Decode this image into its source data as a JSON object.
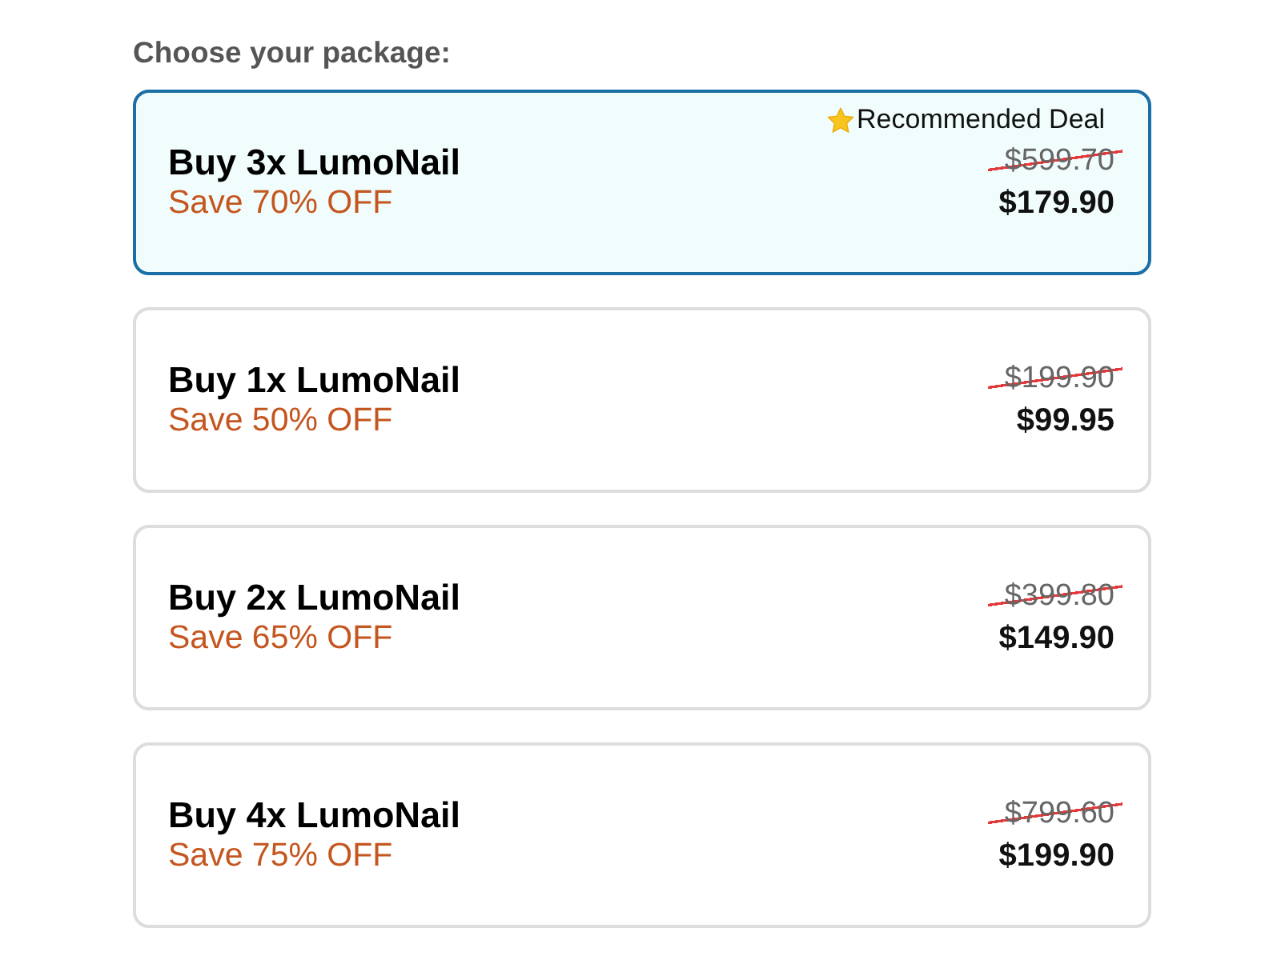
{
  "heading": "Choose your package:",
  "packages": [
    {
      "title": "Buy 3x LumoNail",
      "saving": "Save 70% OFF",
      "old_price": "$599.70",
      "price": "$179.90",
      "badge": "Recommended Deal",
      "selected": true
    },
    {
      "title": "Buy 1x LumoNail",
      "saving": "Save 50% OFF",
      "old_price": "$199.90",
      "price": "$99.95",
      "selected": false
    },
    {
      "title": "Buy 2x LumoNail",
      "saving": "Save 65% OFF",
      "old_price": "$399.80",
      "price": "$149.90",
      "selected": false
    },
    {
      "title": "Buy 4x LumoNail",
      "saving": "Save 75% OFF",
      "old_price": "$799.60",
      "price": "$199.90",
      "selected": false
    }
  ]
}
